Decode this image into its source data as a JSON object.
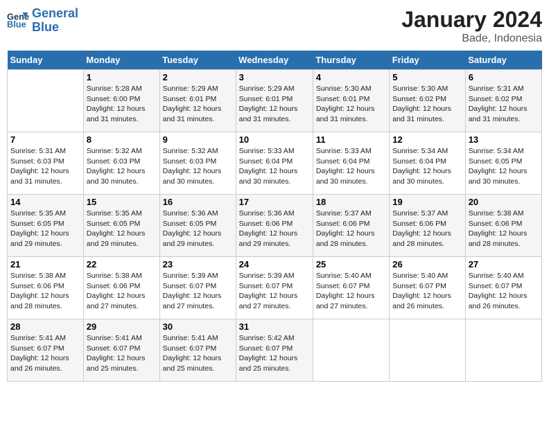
{
  "logo": {
    "text_general": "General",
    "text_blue": "Blue"
  },
  "header": {
    "month": "January 2024",
    "location": "Bade, Indonesia"
  },
  "weekdays": [
    "Sunday",
    "Monday",
    "Tuesday",
    "Wednesday",
    "Thursday",
    "Friday",
    "Saturday"
  ],
  "weeks": [
    [
      {
        "day": "",
        "info": ""
      },
      {
        "day": "1",
        "info": "Sunrise: 5:28 AM\nSunset: 6:00 PM\nDaylight: 12 hours and 31 minutes."
      },
      {
        "day": "2",
        "info": "Sunrise: 5:29 AM\nSunset: 6:01 PM\nDaylight: 12 hours and 31 minutes."
      },
      {
        "day": "3",
        "info": "Sunrise: 5:29 AM\nSunset: 6:01 PM\nDaylight: 12 hours and 31 minutes."
      },
      {
        "day": "4",
        "info": "Sunrise: 5:30 AM\nSunset: 6:01 PM\nDaylight: 12 hours and 31 minutes."
      },
      {
        "day": "5",
        "info": "Sunrise: 5:30 AM\nSunset: 6:02 PM\nDaylight: 12 hours and 31 minutes."
      },
      {
        "day": "6",
        "info": "Sunrise: 5:31 AM\nSunset: 6:02 PM\nDaylight: 12 hours and 31 minutes."
      }
    ],
    [
      {
        "day": "7",
        "info": "Sunrise: 5:31 AM\nSunset: 6:03 PM\nDaylight: 12 hours and 31 minutes."
      },
      {
        "day": "8",
        "info": "Sunrise: 5:32 AM\nSunset: 6:03 PM\nDaylight: 12 hours and 30 minutes."
      },
      {
        "day": "9",
        "info": "Sunrise: 5:32 AM\nSunset: 6:03 PM\nDaylight: 12 hours and 30 minutes."
      },
      {
        "day": "10",
        "info": "Sunrise: 5:33 AM\nSunset: 6:04 PM\nDaylight: 12 hours and 30 minutes."
      },
      {
        "day": "11",
        "info": "Sunrise: 5:33 AM\nSunset: 6:04 PM\nDaylight: 12 hours and 30 minutes."
      },
      {
        "day": "12",
        "info": "Sunrise: 5:34 AM\nSunset: 6:04 PM\nDaylight: 12 hours and 30 minutes."
      },
      {
        "day": "13",
        "info": "Sunrise: 5:34 AM\nSunset: 6:05 PM\nDaylight: 12 hours and 30 minutes."
      }
    ],
    [
      {
        "day": "14",
        "info": "Sunrise: 5:35 AM\nSunset: 6:05 PM\nDaylight: 12 hours and 29 minutes."
      },
      {
        "day": "15",
        "info": "Sunrise: 5:35 AM\nSunset: 6:05 PM\nDaylight: 12 hours and 29 minutes."
      },
      {
        "day": "16",
        "info": "Sunrise: 5:36 AM\nSunset: 6:05 PM\nDaylight: 12 hours and 29 minutes."
      },
      {
        "day": "17",
        "info": "Sunrise: 5:36 AM\nSunset: 6:06 PM\nDaylight: 12 hours and 29 minutes."
      },
      {
        "day": "18",
        "info": "Sunrise: 5:37 AM\nSunset: 6:06 PM\nDaylight: 12 hours and 28 minutes."
      },
      {
        "day": "19",
        "info": "Sunrise: 5:37 AM\nSunset: 6:06 PM\nDaylight: 12 hours and 28 minutes."
      },
      {
        "day": "20",
        "info": "Sunrise: 5:38 AM\nSunset: 6:06 PM\nDaylight: 12 hours and 28 minutes."
      }
    ],
    [
      {
        "day": "21",
        "info": "Sunrise: 5:38 AM\nSunset: 6:06 PM\nDaylight: 12 hours and 28 minutes."
      },
      {
        "day": "22",
        "info": "Sunrise: 5:38 AM\nSunset: 6:06 PM\nDaylight: 12 hours and 27 minutes."
      },
      {
        "day": "23",
        "info": "Sunrise: 5:39 AM\nSunset: 6:07 PM\nDaylight: 12 hours and 27 minutes."
      },
      {
        "day": "24",
        "info": "Sunrise: 5:39 AM\nSunset: 6:07 PM\nDaylight: 12 hours and 27 minutes."
      },
      {
        "day": "25",
        "info": "Sunrise: 5:40 AM\nSunset: 6:07 PM\nDaylight: 12 hours and 27 minutes."
      },
      {
        "day": "26",
        "info": "Sunrise: 5:40 AM\nSunset: 6:07 PM\nDaylight: 12 hours and 26 minutes."
      },
      {
        "day": "27",
        "info": "Sunrise: 5:40 AM\nSunset: 6:07 PM\nDaylight: 12 hours and 26 minutes."
      }
    ],
    [
      {
        "day": "28",
        "info": "Sunrise: 5:41 AM\nSunset: 6:07 PM\nDaylight: 12 hours and 26 minutes."
      },
      {
        "day": "29",
        "info": "Sunrise: 5:41 AM\nSunset: 6:07 PM\nDaylight: 12 hours and 25 minutes."
      },
      {
        "day": "30",
        "info": "Sunrise: 5:41 AM\nSunset: 6:07 PM\nDaylight: 12 hours and 25 minutes."
      },
      {
        "day": "31",
        "info": "Sunrise: 5:42 AM\nSunset: 6:07 PM\nDaylight: 12 hours and 25 minutes."
      },
      {
        "day": "",
        "info": ""
      },
      {
        "day": "",
        "info": ""
      },
      {
        "day": "",
        "info": ""
      }
    ]
  ]
}
